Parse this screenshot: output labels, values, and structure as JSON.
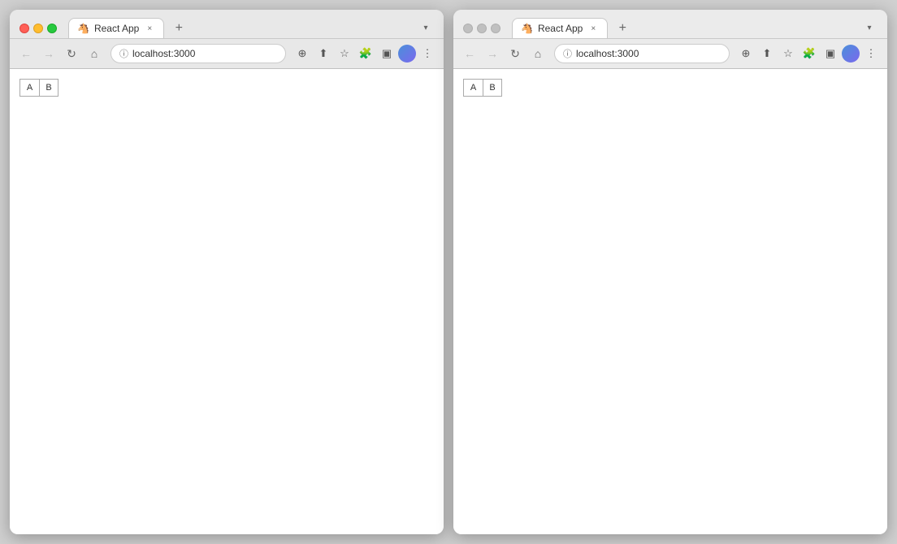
{
  "browser1": {
    "title": "React App",
    "url": "localhost:3000",
    "tab_close_label": "×",
    "tab_new_label": "+",
    "tab_list_label": "▾",
    "favicon": "🐴",
    "nav": {
      "back": "←",
      "forward": "→",
      "reload": "↻",
      "home": "⌂"
    },
    "toolbar": {
      "zoom": "⊕",
      "share": "↑",
      "bookmark": "☆",
      "extensions": "🧩",
      "puzzle": "⊞",
      "more": "⋮"
    },
    "buttons": {
      "a_label": "A",
      "b_label": "B"
    }
  },
  "browser2": {
    "title": "React App",
    "url": "localhost:3000",
    "tab_close_label": "×",
    "tab_new_label": "+",
    "tab_list_label": "▾",
    "favicon": "🐴",
    "nav": {
      "back": "←",
      "forward": "→",
      "reload": "↻",
      "home": "⌂"
    },
    "toolbar": {
      "zoom": "⊕",
      "share": "↑",
      "bookmark": "☆",
      "extensions": "🧩",
      "puzzle": "⊞",
      "more": "⋮"
    },
    "buttons": {
      "a_label": "A",
      "b_label": "B"
    }
  }
}
